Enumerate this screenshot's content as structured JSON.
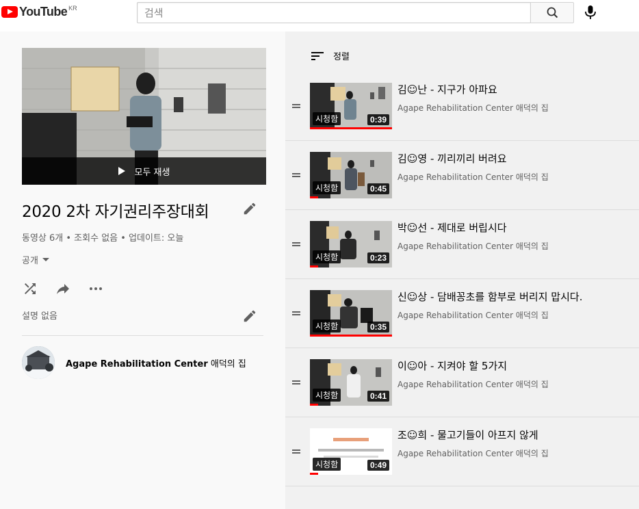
{
  "header": {
    "logo_text": "YouTube",
    "logo_country": "KR",
    "search_placeholder": "검색"
  },
  "playlist": {
    "play_all_label": "모두 재생",
    "title": "2020 2차 자기권리주장대회",
    "stats": "동영상 6개 • 조회수 없음 • 업데이트: 오늘",
    "privacy": "공개",
    "description": "설명 없음",
    "owner_bold": "Agape Rehabilitation Center",
    "owner_rest": " 애덕의 집"
  },
  "sort": {
    "label": "정렬"
  },
  "videos": [
    {
      "title": "김☺난 - 지구가 아파요",
      "channel": "Agape Rehabilitation Center 애덕의 집",
      "watched": "시청함",
      "duration": "0:39",
      "progress": 1.0
    },
    {
      "title": "김☺영 - 끼리끼리 버려요",
      "channel": "Agape Rehabilitation Center 애덕의 집",
      "watched": "시청함",
      "duration": "0:45",
      "progress": 0.1
    },
    {
      "title": "박☺선 - 제대로 버립시다",
      "channel": "Agape Rehabilitation Center 애덕의 집",
      "watched": "시청함",
      "duration": "0:23",
      "progress": 0.1
    },
    {
      "title": "신☺상 - 담배꽁초를 함부로 버리지 맙시다.",
      "channel": "Agape Rehabilitation Center 애덕의 집",
      "watched": "시청함",
      "duration": "0:35",
      "progress": 1.0
    },
    {
      "title": "이☺아 - 지켜야 할 5가지",
      "channel": "Agape Rehabilitation Center 애덕의 집",
      "watched": "시청함",
      "duration": "0:41",
      "progress": 0.1
    },
    {
      "title": "조☺희 - 물고기들이 아프지 않게",
      "channel": "Agape Rehabilitation Center 애덕의 집",
      "watched": "시청함",
      "duration": "0:49",
      "progress": 0.1
    }
  ],
  "colors": {
    "brand": "#ff0000",
    "progress": "#ff0000",
    "text_secondary": "#606060"
  }
}
